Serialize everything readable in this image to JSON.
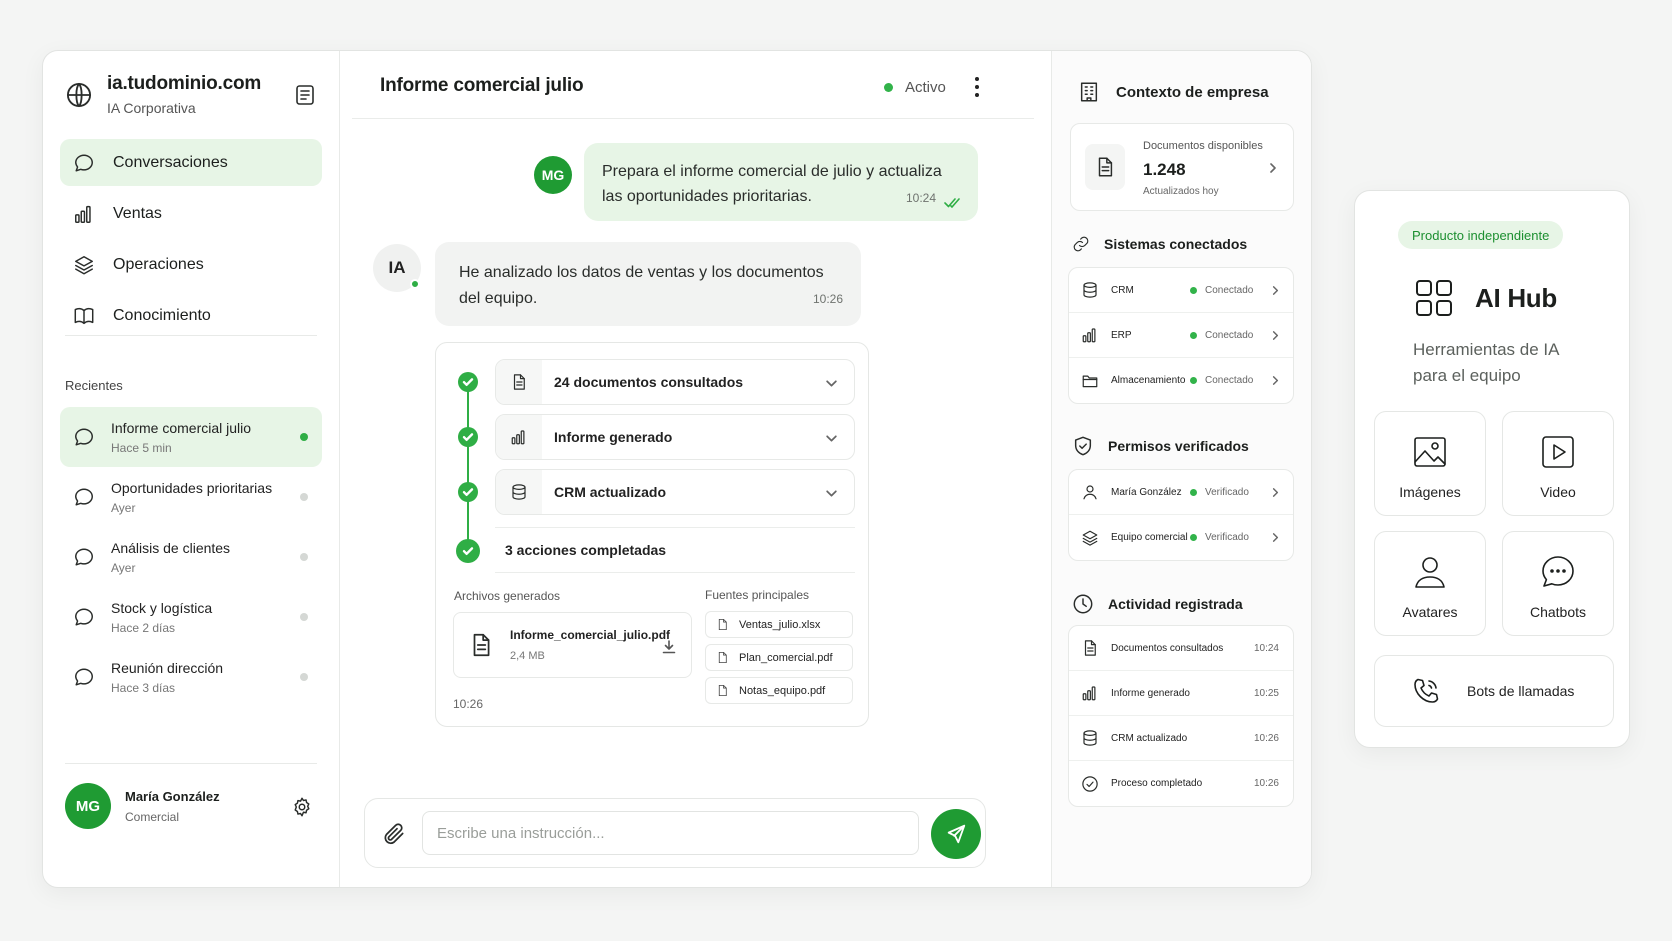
{
  "sidebar": {
    "domain": "ia.tudominio.com",
    "subtitle": "IA Corporativa",
    "nav": [
      {
        "label": "Conversaciones",
        "icon": "chat-icon",
        "active": true
      },
      {
        "label": "Ventas",
        "icon": "bar-chart-icon"
      },
      {
        "label": "Operaciones",
        "icon": "layers-icon"
      },
      {
        "label": "Conocimiento",
        "icon": "book-icon"
      }
    ],
    "recents_title": "Recientes",
    "recents": [
      {
        "name": "Informe comercial julio",
        "time": "Hace 5 min",
        "active": true
      },
      {
        "name": "Oportunidades prioritarias",
        "time": "Ayer"
      },
      {
        "name": "Análisis de clientes",
        "time": "Ayer"
      },
      {
        "name": "Stock y logística",
        "time": "Hace 2 días"
      },
      {
        "name": "Reunión dirección",
        "time": "Hace 3 días"
      }
    ],
    "user": {
      "initials": "MG",
      "name": "María González",
      "role": "Comercial"
    }
  },
  "chat": {
    "title": "Informe comercial julio",
    "status": "Activo",
    "user_initials": "MG",
    "ai_initials": "IA",
    "user_message": "Prepara el informe comercial de julio y actualiza las oportunidades prioritarias.",
    "user_time": "10:24",
    "ai_message": "He analizado los datos de ventas y los documentos del equipo.",
    "ai_time": "10:26",
    "steps": [
      {
        "label": "24 documentos consultados",
        "icon": "document-icon"
      },
      {
        "label": "Informe generado",
        "icon": "bar-chart-icon"
      },
      {
        "label": "CRM actualizado",
        "icon": "database-icon"
      }
    ],
    "completed_label": "3 acciones completadas",
    "files_title": "Archivos generados",
    "file": {
      "name": "Informe_comercial_julio.pdf",
      "size": "2,4 MB"
    },
    "sources_title": "Fuentes principales",
    "sources": [
      "Ventas_julio.xlsx",
      "Plan_comercial.pdf",
      "Notas_equipo.pdf"
    ],
    "card_time": "10:26",
    "input_placeholder": "Escribe una instrucción..."
  },
  "context": {
    "title": "Contexto de empresa",
    "docs": {
      "label": "Documentos disponibles",
      "count": "1.248",
      "sub": "Actualizados hoy"
    },
    "systems_title": "Sistemas conectados",
    "systems": [
      {
        "name": "CRM",
        "state": "Conectado",
        "icon": "database-icon"
      },
      {
        "name": "ERP",
        "state": "Conectado",
        "icon": "bar-chart-icon"
      },
      {
        "name": "Almacenamiento",
        "state": "Conectado",
        "icon": "folder-icon"
      }
    ],
    "permissions_title": "Permisos verificados",
    "permissions": [
      {
        "name": "María González",
        "state": "Verificado",
        "icon": "user-icon"
      },
      {
        "name": "Equipo comercial",
        "state": "Verificado",
        "icon": "layers-icon"
      }
    ],
    "activity_title": "Actividad registrada",
    "activity": [
      {
        "name": "Documentos consultados",
        "time": "10:24",
        "icon": "document-icon"
      },
      {
        "name": "Informe generado",
        "time": "10:25",
        "icon": "bar-chart-icon"
      },
      {
        "name": "CRM actualizado",
        "time": "10:26",
        "icon": "database-icon"
      },
      {
        "name": "Proceso completado",
        "time": "10:26",
        "icon": "check-circle-icon"
      }
    ]
  },
  "hub": {
    "badge": "Producto independiente",
    "title": "AI Hub",
    "description": "Herramientas de IA para el equipo",
    "tiles": [
      {
        "label": "Imágenes",
        "icon": "image-icon"
      },
      {
        "label": "Video",
        "icon": "video-icon"
      },
      {
        "label": "Avatares",
        "icon": "avatar-icon"
      },
      {
        "label": "Chatbots",
        "icon": "chatbot-icon"
      }
    ],
    "wide_tile": {
      "label": "Bots de llamadas",
      "icon": "phone-icon"
    }
  },
  "colors": {
    "accent": "#1f9b33",
    "accent_light": "#e7f5e6",
    "status_green": "#2fae45"
  }
}
